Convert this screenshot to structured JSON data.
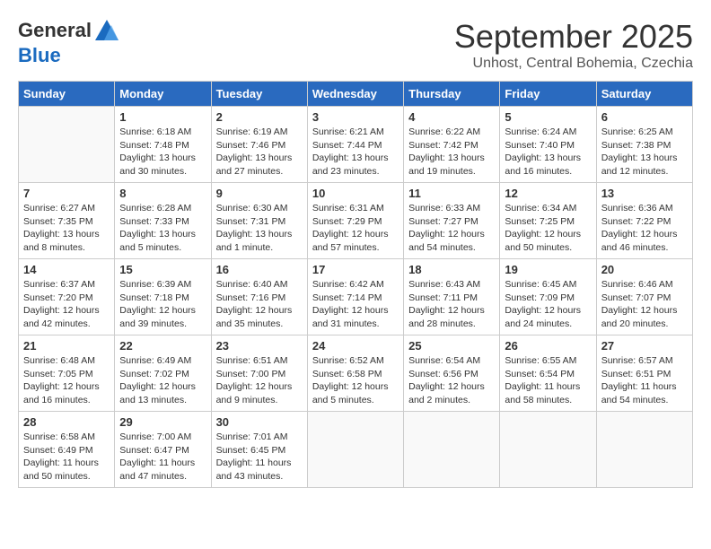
{
  "header": {
    "logo_line1": "General",
    "logo_line2": "Blue",
    "month_title": "September 2025",
    "subtitle": "Unhost, Central Bohemia, Czechia"
  },
  "days_of_week": [
    "Sunday",
    "Monday",
    "Tuesday",
    "Wednesday",
    "Thursday",
    "Friday",
    "Saturday"
  ],
  "weeks": [
    [
      {
        "num": "",
        "info": ""
      },
      {
        "num": "1",
        "info": "Sunrise: 6:18 AM\nSunset: 7:48 PM\nDaylight: 13 hours\nand 30 minutes."
      },
      {
        "num": "2",
        "info": "Sunrise: 6:19 AM\nSunset: 7:46 PM\nDaylight: 13 hours\nand 27 minutes."
      },
      {
        "num": "3",
        "info": "Sunrise: 6:21 AM\nSunset: 7:44 PM\nDaylight: 13 hours\nand 23 minutes."
      },
      {
        "num": "4",
        "info": "Sunrise: 6:22 AM\nSunset: 7:42 PM\nDaylight: 13 hours\nand 19 minutes."
      },
      {
        "num": "5",
        "info": "Sunrise: 6:24 AM\nSunset: 7:40 PM\nDaylight: 13 hours\nand 16 minutes."
      },
      {
        "num": "6",
        "info": "Sunrise: 6:25 AM\nSunset: 7:38 PM\nDaylight: 13 hours\nand 12 minutes."
      }
    ],
    [
      {
        "num": "7",
        "info": "Sunrise: 6:27 AM\nSunset: 7:35 PM\nDaylight: 13 hours\nand 8 minutes."
      },
      {
        "num": "8",
        "info": "Sunrise: 6:28 AM\nSunset: 7:33 PM\nDaylight: 13 hours\nand 5 minutes."
      },
      {
        "num": "9",
        "info": "Sunrise: 6:30 AM\nSunset: 7:31 PM\nDaylight: 13 hours\nand 1 minute."
      },
      {
        "num": "10",
        "info": "Sunrise: 6:31 AM\nSunset: 7:29 PM\nDaylight: 12 hours\nand 57 minutes."
      },
      {
        "num": "11",
        "info": "Sunrise: 6:33 AM\nSunset: 7:27 PM\nDaylight: 12 hours\nand 54 minutes."
      },
      {
        "num": "12",
        "info": "Sunrise: 6:34 AM\nSunset: 7:25 PM\nDaylight: 12 hours\nand 50 minutes."
      },
      {
        "num": "13",
        "info": "Sunrise: 6:36 AM\nSunset: 7:22 PM\nDaylight: 12 hours\nand 46 minutes."
      }
    ],
    [
      {
        "num": "14",
        "info": "Sunrise: 6:37 AM\nSunset: 7:20 PM\nDaylight: 12 hours\nand 42 minutes."
      },
      {
        "num": "15",
        "info": "Sunrise: 6:39 AM\nSunset: 7:18 PM\nDaylight: 12 hours\nand 39 minutes."
      },
      {
        "num": "16",
        "info": "Sunrise: 6:40 AM\nSunset: 7:16 PM\nDaylight: 12 hours\nand 35 minutes."
      },
      {
        "num": "17",
        "info": "Sunrise: 6:42 AM\nSunset: 7:14 PM\nDaylight: 12 hours\nand 31 minutes."
      },
      {
        "num": "18",
        "info": "Sunrise: 6:43 AM\nSunset: 7:11 PM\nDaylight: 12 hours\nand 28 minutes."
      },
      {
        "num": "19",
        "info": "Sunrise: 6:45 AM\nSunset: 7:09 PM\nDaylight: 12 hours\nand 24 minutes."
      },
      {
        "num": "20",
        "info": "Sunrise: 6:46 AM\nSunset: 7:07 PM\nDaylight: 12 hours\nand 20 minutes."
      }
    ],
    [
      {
        "num": "21",
        "info": "Sunrise: 6:48 AM\nSunset: 7:05 PM\nDaylight: 12 hours\nand 16 minutes."
      },
      {
        "num": "22",
        "info": "Sunrise: 6:49 AM\nSunset: 7:02 PM\nDaylight: 12 hours\nand 13 minutes."
      },
      {
        "num": "23",
        "info": "Sunrise: 6:51 AM\nSunset: 7:00 PM\nDaylight: 12 hours\nand 9 minutes."
      },
      {
        "num": "24",
        "info": "Sunrise: 6:52 AM\nSunset: 6:58 PM\nDaylight: 12 hours\nand 5 minutes."
      },
      {
        "num": "25",
        "info": "Sunrise: 6:54 AM\nSunset: 6:56 PM\nDaylight: 12 hours\nand 2 minutes."
      },
      {
        "num": "26",
        "info": "Sunrise: 6:55 AM\nSunset: 6:54 PM\nDaylight: 11 hours\nand 58 minutes."
      },
      {
        "num": "27",
        "info": "Sunrise: 6:57 AM\nSunset: 6:51 PM\nDaylight: 11 hours\nand 54 minutes."
      }
    ],
    [
      {
        "num": "28",
        "info": "Sunrise: 6:58 AM\nSunset: 6:49 PM\nDaylight: 11 hours\nand 50 minutes."
      },
      {
        "num": "29",
        "info": "Sunrise: 7:00 AM\nSunset: 6:47 PM\nDaylight: 11 hours\nand 47 minutes."
      },
      {
        "num": "30",
        "info": "Sunrise: 7:01 AM\nSunset: 6:45 PM\nDaylight: 11 hours\nand 43 minutes."
      },
      {
        "num": "",
        "info": ""
      },
      {
        "num": "",
        "info": ""
      },
      {
        "num": "",
        "info": ""
      },
      {
        "num": "",
        "info": ""
      }
    ]
  ]
}
